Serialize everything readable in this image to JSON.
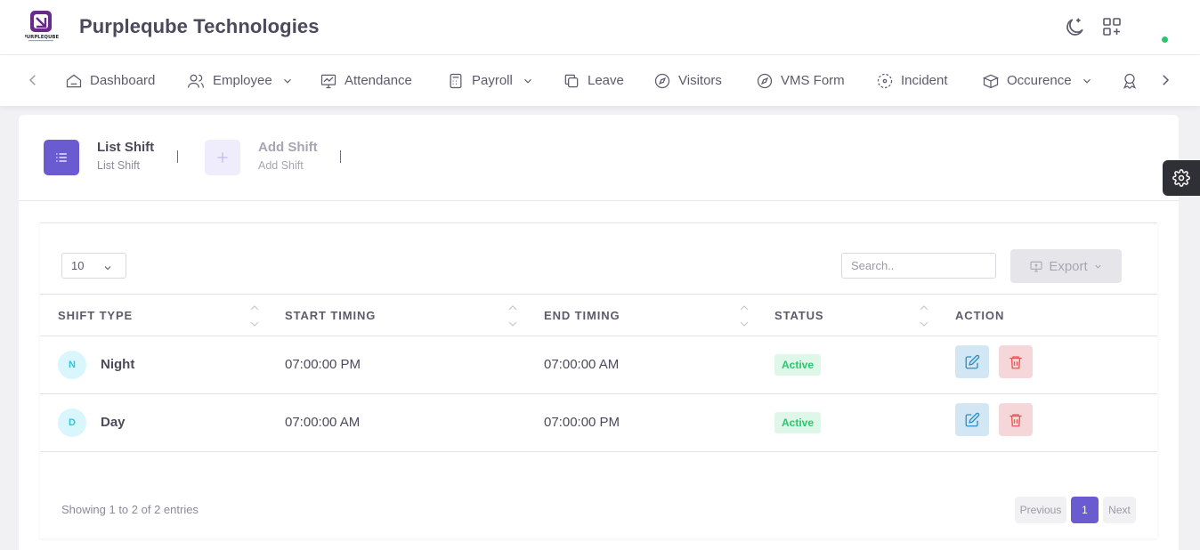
{
  "header": {
    "company": "Purpleqube Technologies",
    "logo_text": "PURPLEQUBE"
  },
  "nav": {
    "items": [
      {
        "label": "Dashboard",
        "icon": "home-icon"
      },
      {
        "label": "Employee",
        "icon": "users-icon",
        "dropdown": true
      },
      {
        "label": "Attendance",
        "icon": "chart-monitor-icon"
      },
      {
        "label": "Payroll",
        "icon": "calculator-icon",
        "dropdown": true
      },
      {
        "label": "Leave",
        "icon": "copy-icon"
      },
      {
        "label": "Visitors",
        "icon": "compass-icon"
      },
      {
        "label": "VMS Form",
        "icon": "compass-icon"
      },
      {
        "label": "Incident",
        "icon": "incident-icon"
      },
      {
        "label": "Occurence",
        "icon": "boxes-icon",
        "dropdown": true
      }
    ]
  },
  "tabs": [
    {
      "title": "List Shift",
      "subtitle": "List Shift",
      "active": true
    },
    {
      "title": "Add Shift",
      "subtitle": "Add Shift",
      "active": false
    }
  ],
  "table": {
    "page_length": "10",
    "search_placeholder": "Search..",
    "export_label": "Export",
    "columns": [
      "SHIFT TYPE",
      "START TIMING",
      "END TIMING",
      "STATUS",
      "ACTION"
    ],
    "rows": [
      {
        "initial": "N",
        "shift_type": "Night",
        "start": "07:00:00 PM",
        "end": "07:00:00 AM",
        "status": "Active"
      },
      {
        "initial": "D",
        "shift_type": "Day",
        "start": "07:00:00 AM",
        "end": "07:00:00 PM",
        "status": "Active"
      }
    ],
    "info": "Showing 1 to 2 of 2 entries",
    "pagination": {
      "previous": "Previous",
      "current": "1",
      "next": "Next"
    }
  },
  "colors": {
    "primary": "#6a5bd1",
    "active_badge_text": "#28c76f",
    "active_badge_bg": "#dff7e8",
    "edit_bg": "#d2e7f3",
    "delete_bg": "#f6d7d9"
  }
}
